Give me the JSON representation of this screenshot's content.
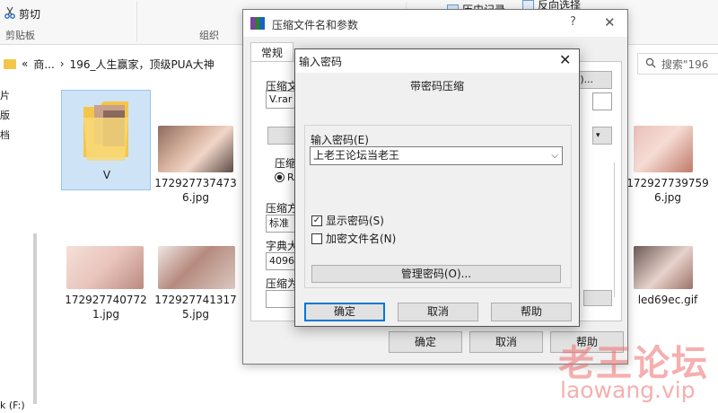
{
  "ribbon": {
    "cut_label": "剪切",
    "clipboard_label": "剪贴板",
    "organize_label": "组织",
    "history_label": "历史记录",
    "invert_label": "反向选择"
  },
  "address": {
    "back_chevrons": "«",
    "part1": "商...",
    "chevron": "›",
    "part2": "196_人生赢家，顶级PUA大神",
    "search_placeholder": "搜索\"196"
  },
  "nav": {
    "drive_label": "k (F:)"
  },
  "files": [
    {
      "name": "V"
    },
    {
      "name": "1729277374736.jpg"
    },
    {
      "name": "1729277397596.jpg"
    },
    {
      "name": "1729277407721.jpg"
    },
    {
      "name": "1729277413175.jpg"
    },
    {
      "name": "led69ec.gif"
    }
  ],
  "rar_window": {
    "title": "压缩文件名和参数",
    "help_glyph": "?",
    "close_glyph": "✕",
    "tab_general": "常规",
    "label_archive": "压缩文",
    "archive_value": "V.rar",
    "label_format": "压缩",
    "format_option": "RA",
    "label_method": "压缩方",
    "method_value": "标准",
    "label_dict": "字典大",
    "dict_value": "4096",
    "label_split": "压缩为",
    "browse_partial": "B)...",
    "ok": "确定",
    "cancel": "取消",
    "help": "帮助"
  },
  "password_dialog": {
    "title": "输入密码",
    "close_glyph": "✕",
    "heading": "带密码压缩",
    "input_label": "输入密码(E)",
    "password_value": "上老王论坛当老王",
    "show_password": "显示密码(S)",
    "encrypt_names": "加密文件名(N)",
    "manage": "管理密码(O)...",
    "ok": "确定",
    "cancel": "取消",
    "help": "帮助",
    "show_password_checked": true,
    "encrypt_names_checked": false
  },
  "watermark": {
    "chinese": "老王论坛",
    "domain": "laowang.vip"
  },
  "colors": {
    "accent": "#0078d7",
    "folder": "#f3c64a",
    "watermark": "#ee6e6e",
    "selection": "#cfe3f7"
  }
}
